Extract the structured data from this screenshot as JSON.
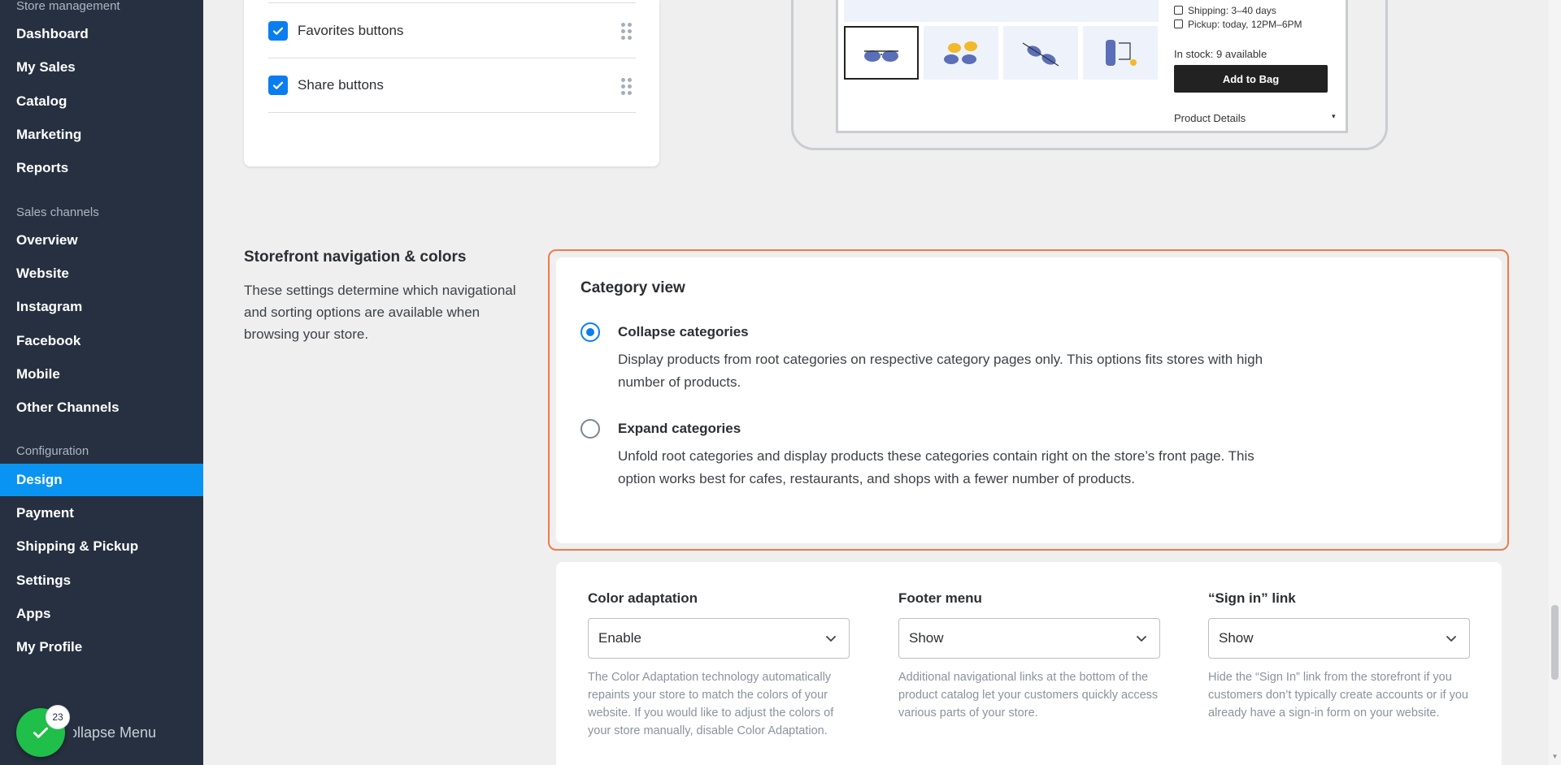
{
  "sidebar": {
    "section_store": "Store management",
    "store_items": [
      "Dashboard",
      "My Sales",
      "Catalog",
      "Marketing",
      "Reports"
    ],
    "section_sales": "Sales channels",
    "sales_items": [
      "Overview",
      "Website",
      "Instagram",
      "Facebook",
      "Mobile",
      "Other Channels"
    ],
    "section_config": "Configuration",
    "config_items": [
      "Design",
      "Payment",
      "Shipping & Pickup",
      "Settings",
      "Apps",
      "My Profile"
    ],
    "active_item": "Design",
    "collapse_label": "Collapse Menu",
    "badge_count": "23"
  },
  "product_options": {
    "items": [
      {
        "label": "Favorites buttons",
        "checked": true
      },
      {
        "label": "Share buttons",
        "checked": true
      }
    ]
  },
  "preview": {
    "shipping": "Shipping: 3–40 days",
    "pickup": "Pickup: today, 12PM–6PM",
    "stock": "In stock: 9 available",
    "add_button": "Add to Bag",
    "details": "Product Details"
  },
  "nav_section": {
    "title": "Storefront navigation & colors",
    "description": "These settings determine which navigational and sorting options are available when browsing your store."
  },
  "category_view": {
    "title": "Category view",
    "options": [
      {
        "label": "Collapse categories",
        "description": "Display products from root categories on respective category pages only. This options fits stores with high number of products.",
        "selected": true
      },
      {
        "label": "Expand categories",
        "description": "Unfold root categories and display products these categories contain right on the store’s front page. This option works best for cafes, restaurants, and shops with a fewer number of products.",
        "selected": false
      }
    ]
  },
  "settings": {
    "color_adaptation": {
      "label": "Color adaptation",
      "value": "Enable",
      "help": "The Color Adaptation technology automatically repaints your store to match the colors of your website. If you would like to adjust the colors of your store manually, disable Color Adaptation."
    },
    "footer_menu": {
      "label": "Footer menu",
      "value": "Show",
      "help": "Additional navigational links at the bottom of the product catalog let your customers quickly access various parts of your store."
    },
    "sign_in_link": {
      "label": "“Sign in” link",
      "value": "Show",
      "help": "Hide the “Sign In” link from the storefront if you customers don’t typically create accounts or if you already have a sign-in form on your website."
    }
  },
  "colors": {
    "sidebar_bg": "#263040",
    "active_item": "#0a94f2",
    "accent_blue": "#0a7ef0",
    "highlight_frame": "#f07b4a",
    "success_green": "#1fbf4a"
  },
  "icons": [
    "checkbox-checked-icon",
    "drag-handle-icon",
    "radio-selected-icon",
    "radio-unselected-icon",
    "chevron-down-icon",
    "checkmark-icon",
    "truck-icon",
    "bag-icon",
    "sunglasses-icon"
  ]
}
